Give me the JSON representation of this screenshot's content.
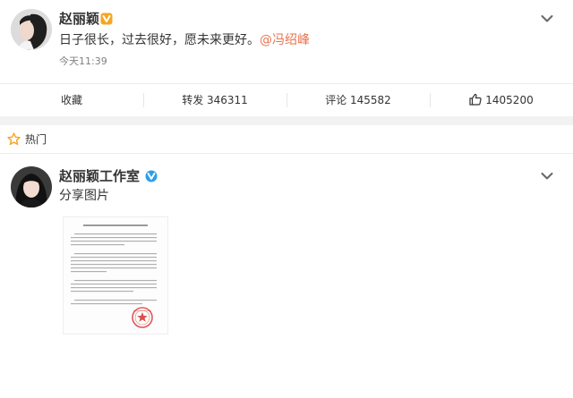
{
  "post": {
    "username": "赵丽颖",
    "text": "日子很长，过去很好，愿未来更好。",
    "mention": "@冯绍峰",
    "timestamp": "今天11:39"
  },
  "actions": {
    "favorite": "收藏",
    "repost": "转发 346311",
    "comment": "评论 145582",
    "like": "1405200"
  },
  "hot": {
    "label": "热门"
  },
  "post2": {
    "username": "赵丽颖工作室",
    "text": "分享图片"
  },
  "colors": {
    "mention": "#eb7350",
    "verified_yellow": "#f5a623",
    "verified_blue": "#2d9fe6",
    "stamp_red": "#d93a3a"
  }
}
